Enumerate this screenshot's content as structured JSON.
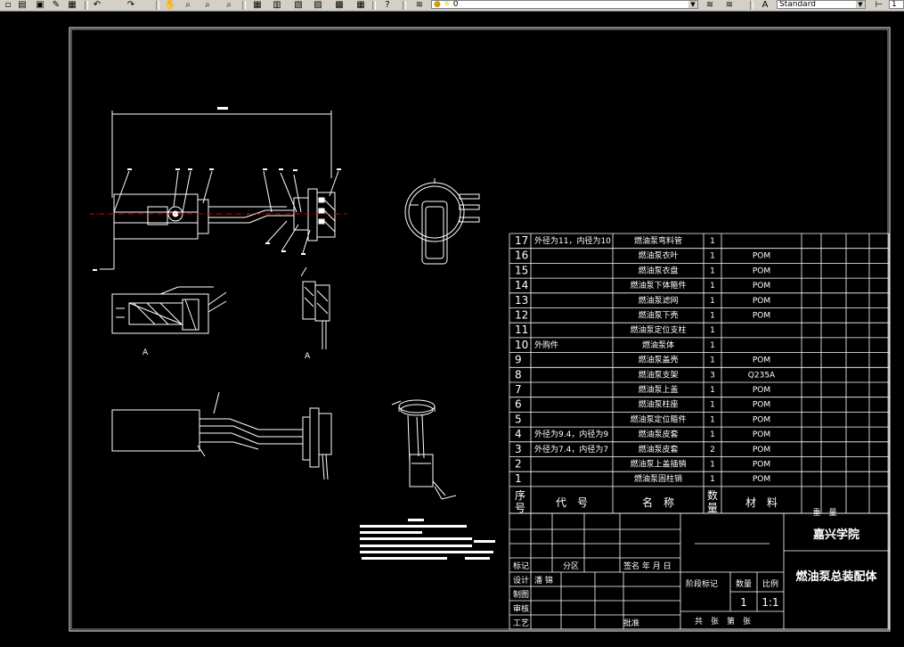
{
  "toolbar": {
    "layer_value": "0",
    "style_value": "Standard",
    "style_short": "1"
  },
  "parts_list": {
    "rows": [
      {
        "no": "17",
        "code": "外径为11，内径为10",
        "name": "燃油泵弯料管",
        "qty": "1",
        "material": ""
      },
      {
        "no": "16",
        "code": "",
        "name": "燃油泵衣叶",
        "qty": "1",
        "material": "POM"
      },
      {
        "no": "15",
        "code": "",
        "name": "燃油泵衣盘",
        "qty": "1",
        "material": "POM"
      },
      {
        "no": "14",
        "code": "",
        "name": "燃油泵下体箍件",
        "qty": "1",
        "material": "POM"
      },
      {
        "no": "13",
        "code": "",
        "name": "燃油泵滤网",
        "qty": "1",
        "material": "POM"
      },
      {
        "no": "12",
        "code": "",
        "name": "燃油泵下壳",
        "qty": "1",
        "material": "POM"
      },
      {
        "no": "11",
        "code": "",
        "name": "燃油泵定位支柱",
        "qty": "1",
        "material": ""
      },
      {
        "no": "10",
        "code": "外购件",
        "name": "燃油泵体",
        "qty": "1",
        "material": ""
      },
      {
        "no": "9",
        "code": "",
        "name": "燃油泵盖壳",
        "qty": "1",
        "material": "POM"
      },
      {
        "no": "8",
        "code": "",
        "name": "燃油泵支架",
        "qty": "3",
        "material": "Q235A"
      },
      {
        "no": "7",
        "code": "",
        "name": "燃油泵上盖",
        "qty": "1",
        "material": "POM"
      },
      {
        "no": "6",
        "code": "",
        "name": "燃油泵柱座",
        "qty": "1",
        "material": "POM"
      },
      {
        "no": "5",
        "code": "",
        "name": "燃油泵定位箍件",
        "qty": "1",
        "material": "POM"
      },
      {
        "no": "4",
        "code": "外径为9.4，内径为9",
        "name": "燃油泵皮套",
        "qty": "1",
        "material": "POM"
      },
      {
        "no": "3",
        "code": "外径为7.4，内径为7",
        "name": "燃油泵皮套",
        "qty": "2",
        "material": "POM"
      },
      {
        "no": "2",
        "code": "",
        "name": "燃油泵上盖插销",
        "qty": "1",
        "material": "POM"
      },
      {
        "no": "1",
        "code": "",
        "name": "燃油泵固柱销",
        "qty": "1",
        "material": "POM"
      }
    ],
    "header": {
      "no_line1": "序",
      "no_line2": "号",
      "code": "代　号",
      "name": "名　称",
      "qty_line1": "数",
      "qty_line2": "量",
      "material": "材　料",
      "weight": "重　量"
    }
  },
  "title_block": {
    "school": "嘉兴学院",
    "drawing_title": "燃油泵总装配体",
    "labels": {
      "mark": "标记",
      "zone": "分区",
      "signature_date": "签名 年 月 日",
      "design": "设计",
      "design_name": "潘 锦",
      "drawn": "制图",
      "check": "审核",
      "process": "工艺",
      "approve": "批准",
      "stage_mark": "阶段标记",
      "weight": "数量",
      "scale": "比例",
      "sheets": "共　张　第　张"
    },
    "scale_value": "1:1",
    "qty_value": "1"
  },
  "drawing": {
    "section_mark_a": "A",
    "section_mark_b": "A"
  }
}
